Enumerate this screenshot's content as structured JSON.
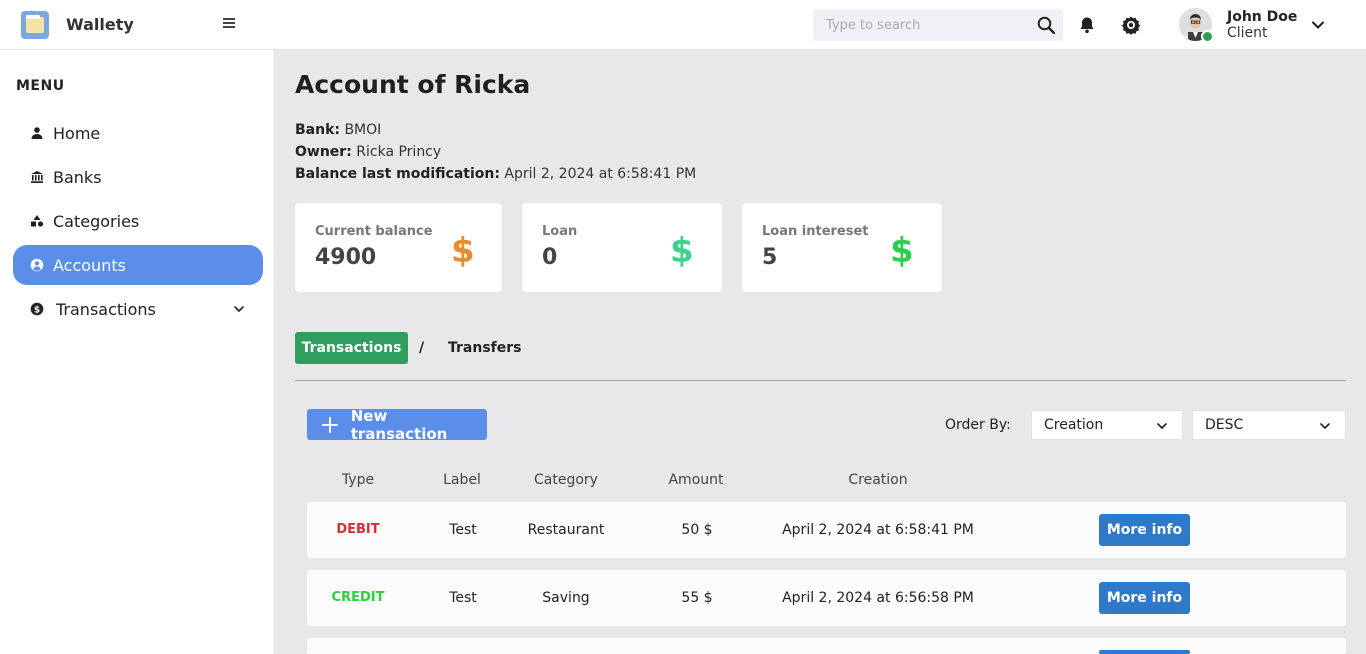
{
  "app": {
    "brand": "Wallety",
    "accent": "#5a8ee8"
  },
  "topbar": {
    "search_placeholder": "Type to search",
    "user": {
      "name": "John Doe",
      "role": "Client"
    }
  },
  "sidebar": {
    "menu_title": "MENU",
    "items": [
      {
        "label": "Home",
        "icon": "person-icon"
      },
      {
        "label": "Banks",
        "icon": "bank-icon"
      },
      {
        "label": "Categories",
        "icon": "shapes-icon"
      },
      {
        "label": "Accounts",
        "icon": "user-circle-icon",
        "active": true
      },
      {
        "label": "Transactions",
        "icon": "dollar-coin-icon"
      }
    ]
  },
  "account": {
    "title": "Account of Ricka",
    "bank_label": "Bank:",
    "bank": "BMOI",
    "owner_label": "Owner:",
    "owner": "Ricka Princy",
    "modified_label": "Balance last modification:",
    "modified": "April 2, 2024 at 6:58:41 PM"
  },
  "cards": [
    {
      "label": "Current balance",
      "value": "4900",
      "color": "#e88a2e"
    },
    {
      "label": "Loan",
      "value": "0",
      "color": "#3fcf8e"
    },
    {
      "label": "Loan intereset",
      "value": "5",
      "color": "#2ecc4f"
    }
  ],
  "tabs": {
    "transactions": "Transactions",
    "separator": "/",
    "transfers": "Transfers"
  },
  "toolbar": {
    "new_label": "New transaction",
    "order_label": "Order By:",
    "order_field": "Creation",
    "order_dir": "DESC"
  },
  "table": {
    "headers": [
      "Type",
      "Label",
      "Category",
      "Amount",
      "Creation"
    ],
    "action_label": "More info",
    "rows": [
      {
        "type": "DEBIT",
        "label": "Test",
        "category": "Restaurant",
        "amount": "50 $",
        "creation": "April 2, 2024 at 6:58:41 PM"
      },
      {
        "type": "CREDIT",
        "label": "Test",
        "category": "Saving",
        "amount": "55 $",
        "creation": "April 2, 2024 at 6:56:58 PM"
      }
    ]
  }
}
